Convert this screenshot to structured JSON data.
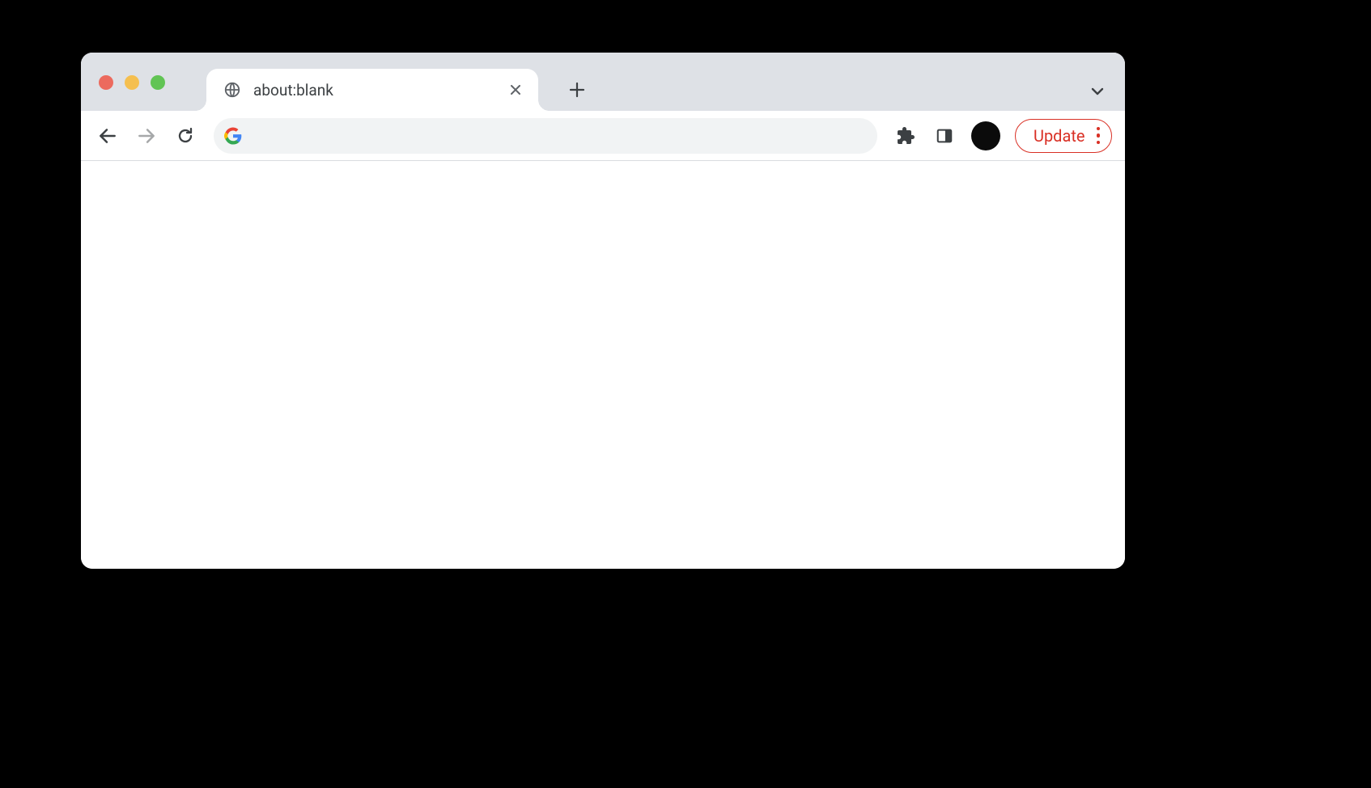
{
  "tab": {
    "title": "about:blank",
    "favicon": "globe-icon"
  },
  "omnibox": {
    "value": "",
    "placeholder": ""
  },
  "toolbar": {
    "update_label": "Update"
  },
  "colors": {
    "tabstrip_bg": "#dee1e6",
    "accent_red": "#d93025"
  }
}
